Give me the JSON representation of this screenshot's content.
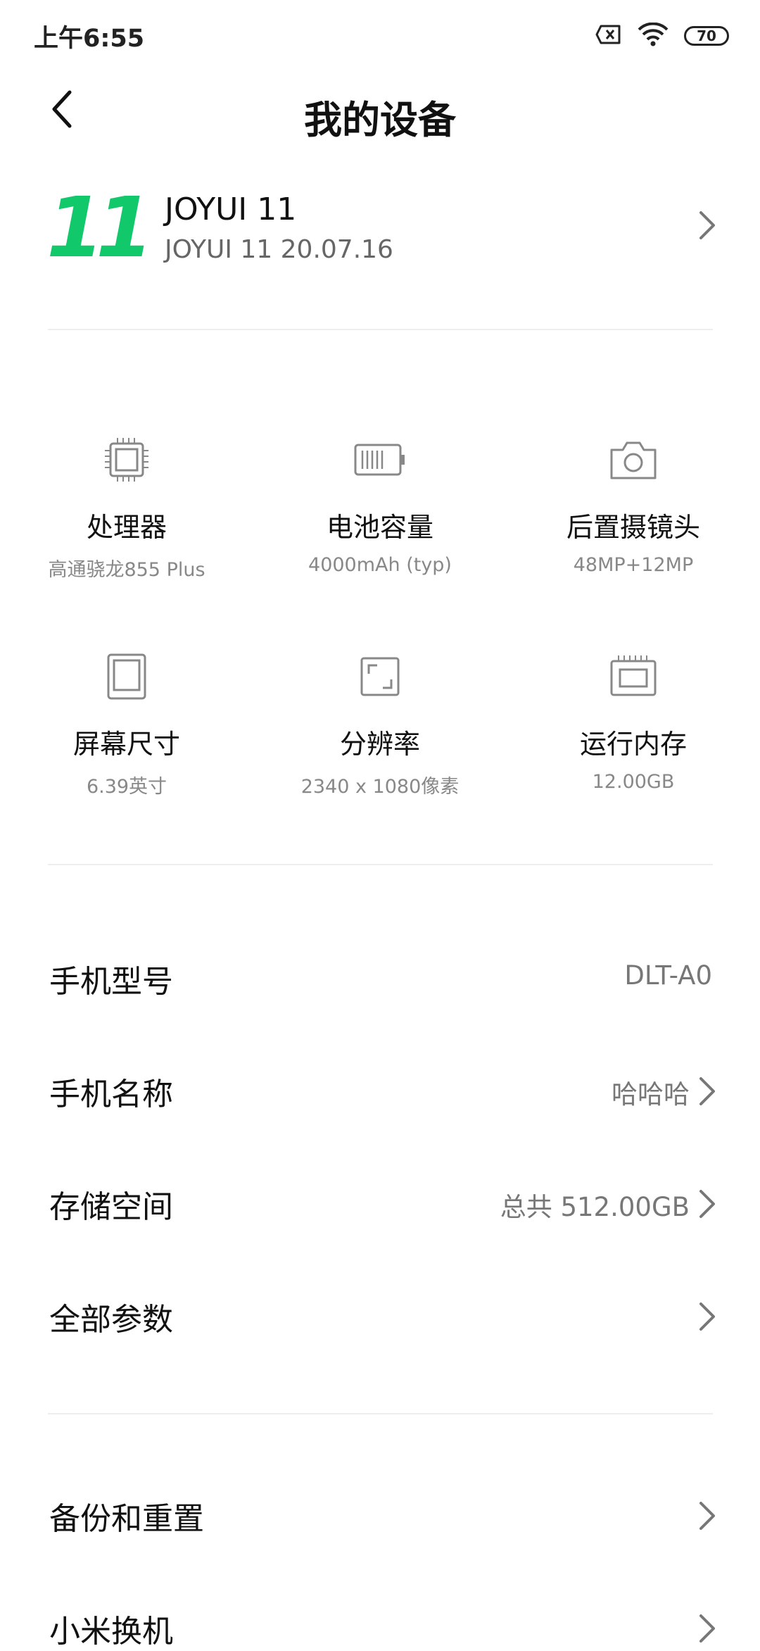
{
  "status_bar": {
    "time": "上午6:55",
    "battery": "70"
  },
  "header": {
    "title": "我的设备"
  },
  "os": {
    "logo_text": "11",
    "name": "JOYUI 11",
    "version": "JOYUI 11 20.07.16"
  },
  "specs": [
    {
      "label": "处理器",
      "value": "高通骁龙855 Plus",
      "icon": "cpu-icon"
    },
    {
      "label": "电池容量",
      "value": "4000mAh (typ)",
      "icon": "battery-icon"
    },
    {
      "label": "后置摄镜头",
      "value": "48MP+12MP",
      "icon": "camera-icon"
    },
    {
      "label": "屏幕尺寸",
      "value": "6.39英寸",
      "icon": "screen-size-icon"
    },
    {
      "label": "分辨率",
      "value": "2340 x 1080像素",
      "icon": "resolution-icon"
    },
    {
      "label": "运行内存",
      "value": "12.00GB",
      "icon": "memory-icon"
    }
  ],
  "rows": [
    {
      "label": "手机型号",
      "value": "DLT-A0"
    },
    {
      "label": "手机名称",
      "value": "哈哈哈"
    },
    {
      "label": "存储空间",
      "value": "总共 512.00GB"
    },
    {
      "label": "全部参数",
      "value": ""
    },
    {
      "label": "备份和重置",
      "value": ""
    },
    {
      "label": "小米换机",
      "value": ""
    }
  ],
  "colors": {
    "accent_green": "#11c96a",
    "text_primary": "#111111",
    "text_secondary": "#777777"
  }
}
